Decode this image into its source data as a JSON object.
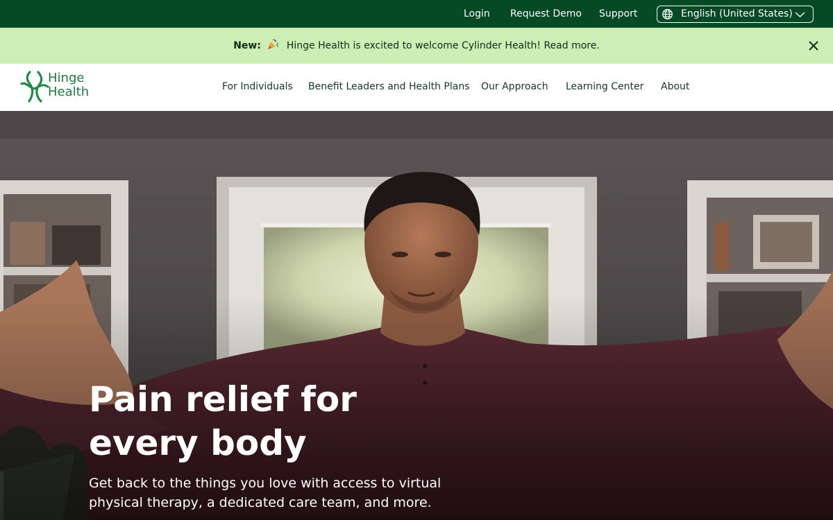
{
  "utility_bar": {
    "login": "Login",
    "request_demo": "Request Demo",
    "support": "Support",
    "language": "English (United States)"
  },
  "announcement": {
    "label": "New:",
    "emoji_icon": "party-popper-icon",
    "text": "Hinge Health is excited to welcome Cylinder Health! Read more."
  },
  "brand": {
    "name": "Hinge\nHealth"
  },
  "nav": {
    "items": [
      {
        "label": "For Individuals"
      },
      {
        "label": "Benefit Leaders and Health Plans"
      },
      {
        "label": "Our Approach"
      },
      {
        "label": "Learning Center"
      },
      {
        "label": "About"
      }
    ]
  },
  "hero": {
    "title_line1": "Pain relief for",
    "title_line2": "every body",
    "subtitle_line1": "Get back to the things you love with access to virtual",
    "subtitle_line2": "physical therapy, a dedicated care team, and more."
  },
  "colors": {
    "utility_bg": "#064a25",
    "banner_bg": "#cdeeb4",
    "brand_green": "#1f7a3d",
    "nav_text": "#143822"
  }
}
